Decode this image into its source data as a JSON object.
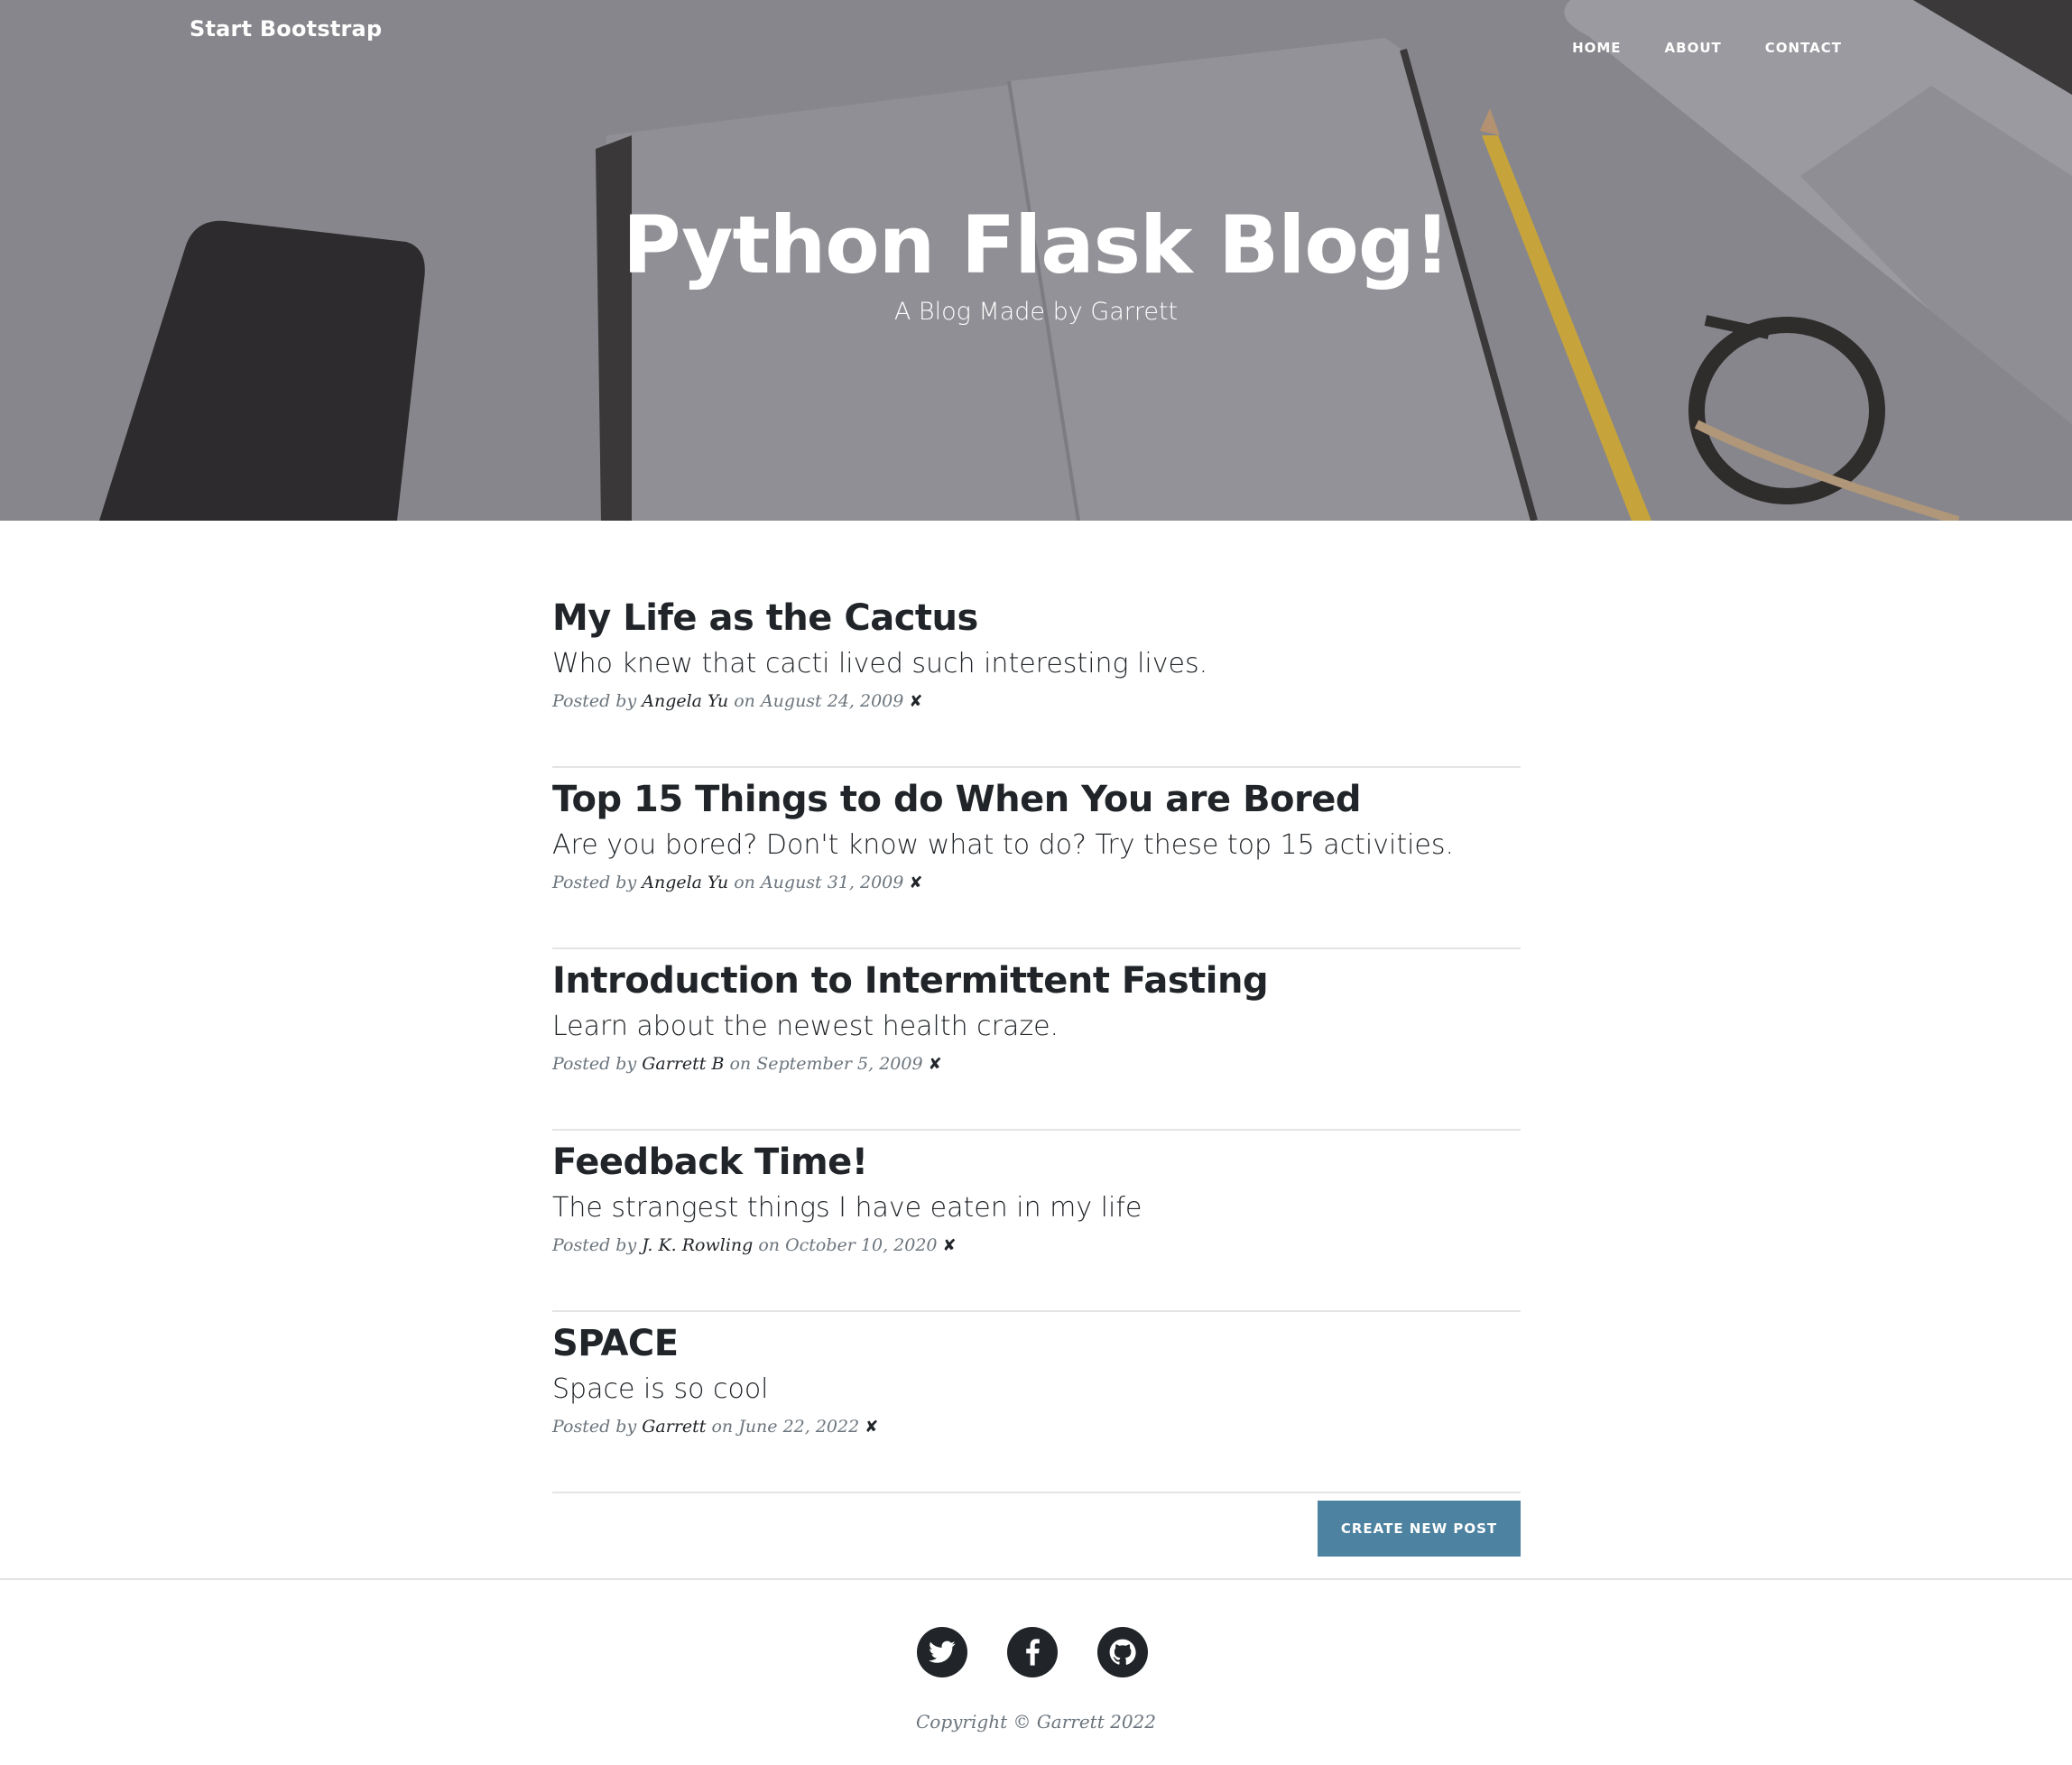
{
  "navbar": {
    "brand": "Start Bootstrap",
    "links": [
      "HOME",
      "ABOUT",
      "CONTACT"
    ]
  },
  "hero": {
    "title": "Python Flask Blog!",
    "subtitle": "A Blog Made by Garrett"
  },
  "posts": [
    {
      "title": "My Life as the Cactus",
      "subtitle": "Who knew that cacti lived such interesting lives.",
      "posted_by": "Posted by",
      "author": "Angela Yu",
      "on": "on",
      "date": "August 24, 2009",
      "delete": "✘"
    },
    {
      "title": "Top 15 Things to do When You are Bored",
      "subtitle": "Are you bored? Don't know what to do? Try these top 15 activities.",
      "posted_by": "Posted by",
      "author": "Angela Yu",
      "on": "on",
      "date": "August 31, 2009",
      "delete": "✘"
    },
    {
      "title": "Introduction to Intermittent Fasting",
      "subtitle": "Learn about the newest health craze.",
      "posted_by": "Posted by",
      "author": "Garrett B",
      "on": "on",
      "date": "September 5, 2009",
      "delete": "✘"
    },
    {
      "title": "Feedback Time!",
      "subtitle": "The strangest things I have eaten in my life",
      "posted_by": "Posted by",
      "author": "J. K. Rowling",
      "on": "on",
      "date": "October 10, 2020",
      "delete": "✘"
    },
    {
      "title": "SPACE",
      "subtitle": "Space is so cool",
      "posted_by": "Posted by",
      "author": "Garrett",
      "on": "on",
      "date": "June 22, 2022",
      "delete": "✘"
    }
  ],
  "create_button": "CREATE NEW POST",
  "footer": {
    "social_icons": [
      "twitter-icon",
      "facebook-icon",
      "github-icon"
    ],
    "copyright": "Copyright © Garrett 2022"
  },
  "colors": {
    "hero_overlay": "#85858b",
    "button": "#4d82a0",
    "text_dark": "#212529",
    "text_muted": "#6c757d"
  }
}
